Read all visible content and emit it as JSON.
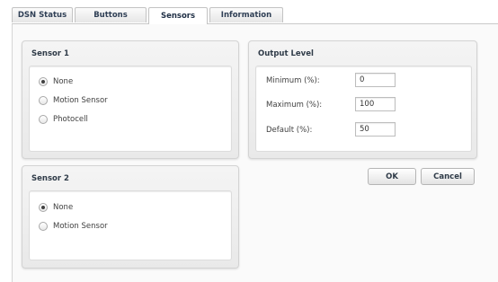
{
  "tabs": [
    {
      "label": "DSN Status"
    },
    {
      "label": "Buttons"
    },
    {
      "label": "Sensors"
    },
    {
      "label": "Information"
    }
  ],
  "active_tab": "Sensors",
  "sensor1": {
    "title": "Sensor 1",
    "options": [
      "None",
      "Motion Sensor",
      "Photocell"
    ],
    "selected": "None"
  },
  "sensor2": {
    "title": "Sensor 2",
    "options": [
      "None",
      "Motion Sensor"
    ],
    "selected": "None"
  },
  "output_level": {
    "title": "Output Level",
    "minimum": {
      "label": "Minimum (%):",
      "value": "0"
    },
    "maximum": {
      "label": "Maximum (%):",
      "value": "100"
    },
    "default": {
      "label": "Default (%):",
      "value": "50"
    }
  },
  "buttons": {
    "ok": "OK",
    "cancel": "Cancel"
  }
}
